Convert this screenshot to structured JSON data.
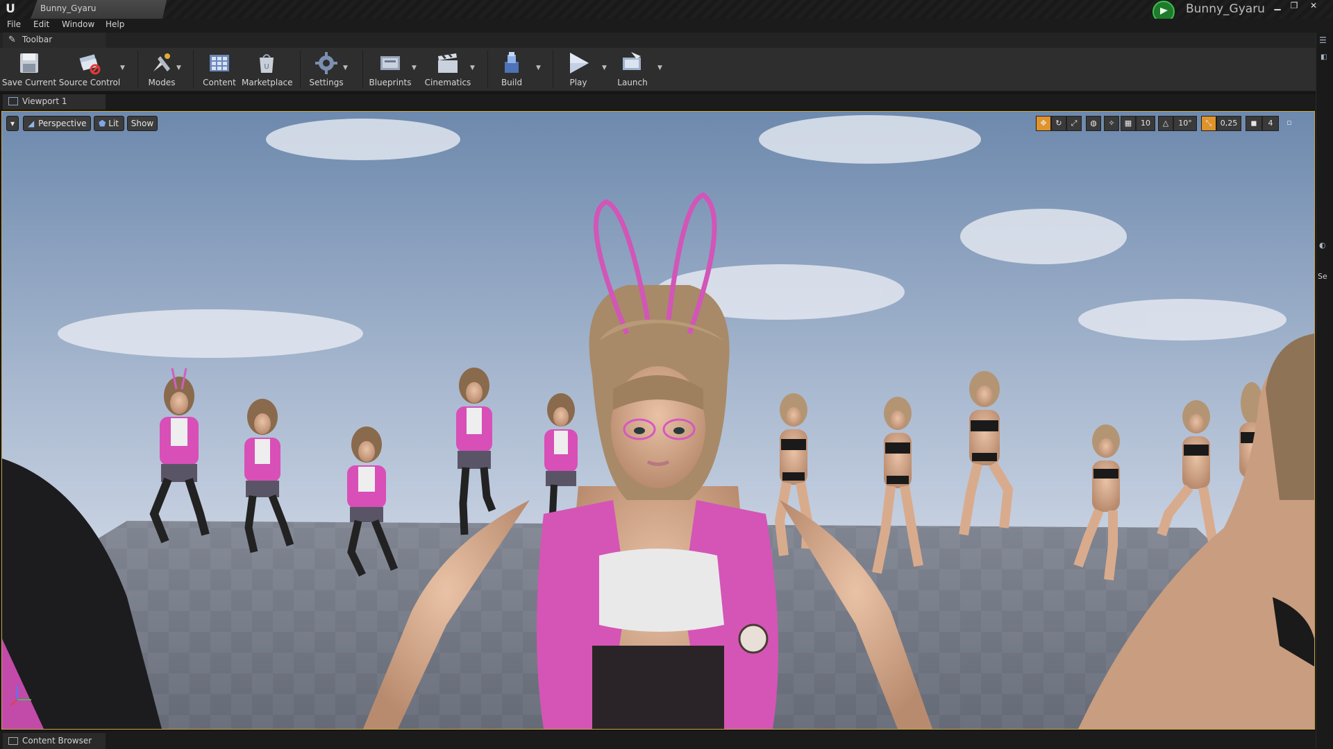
{
  "window": {
    "document_tab": "Bunny_Gyaru",
    "project_name": "Bunny_Gyaru",
    "logo_text": "U"
  },
  "menu": [
    "File",
    "Edit",
    "Window",
    "Help"
  ],
  "toolbar_tab": {
    "label": "Toolbar"
  },
  "toolbar": {
    "save_current": "Save Current",
    "source_control": "Source Control",
    "modes": "Modes",
    "content": "Content",
    "marketplace": "Marketplace",
    "settings": "Settings",
    "blueprints": "Blueprints",
    "cinematics": "Cinematics",
    "build": "Build",
    "play": "Play",
    "launch": "Launch"
  },
  "viewport_tab": {
    "label": "Viewport 1"
  },
  "viewport": {
    "perspective": "Perspective",
    "lit": "Lit",
    "show": "Show",
    "grid_snap": "10",
    "rotation_snap": "10°",
    "scale_snap": "0,25",
    "camera_speed": "4"
  },
  "right_panel": {
    "partial_label": "Se"
  },
  "bottom_tab": {
    "label": "Content Browser"
  },
  "colors": {
    "accent": "#c9a542",
    "snap_active": "#e0932a",
    "project_badge": "#3fbf4f"
  }
}
